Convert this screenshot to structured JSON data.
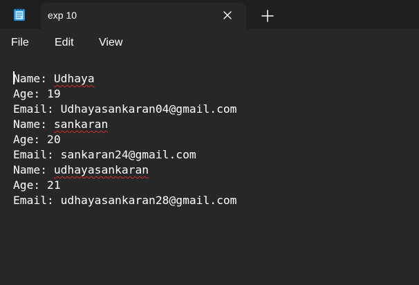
{
  "window": {
    "tab_title": "exp 10",
    "app_icon": "notepad-icon",
    "close_icon": "close-icon",
    "new_tab_icon": "plus-icon"
  },
  "menu": {
    "file": "File",
    "edit": "Edit",
    "view": "View"
  },
  "document": {
    "lines": [
      {
        "label": "Name: ",
        "value": "Udhaya",
        "misspelled": true
      },
      {
        "label": "Age: ",
        "value": "19",
        "misspelled": false
      },
      {
        "label": "Email: ",
        "value": "Udhayasankaran04@gmail.com",
        "misspelled": false
      },
      {
        "label": "Name: ",
        "value": "sankaran",
        "misspelled": true
      },
      {
        "label": "Age: ",
        "value": "20",
        "misspelled": false
      },
      {
        "label": "Email: ",
        "value": "sankaran24@gmail.com",
        "misspelled": false
      },
      {
        "label": "Name: ",
        "value": "udhayasankaran",
        "misspelled": true
      },
      {
        "label": "Age: ",
        "value": "21",
        "misspelled": false
      },
      {
        "label": "Email: ",
        "value": "udhayasankaran28@gmail.com",
        "misspelled": false
      }
    ]
  },
  "colors": {
    "background": "#272727",
    "tabstrip": "#1f1f1f",
    "text": "#ffffff",
    "spellcheck": "#d23030",
    "icon_blue": "#2b8fd6"
  }
}
